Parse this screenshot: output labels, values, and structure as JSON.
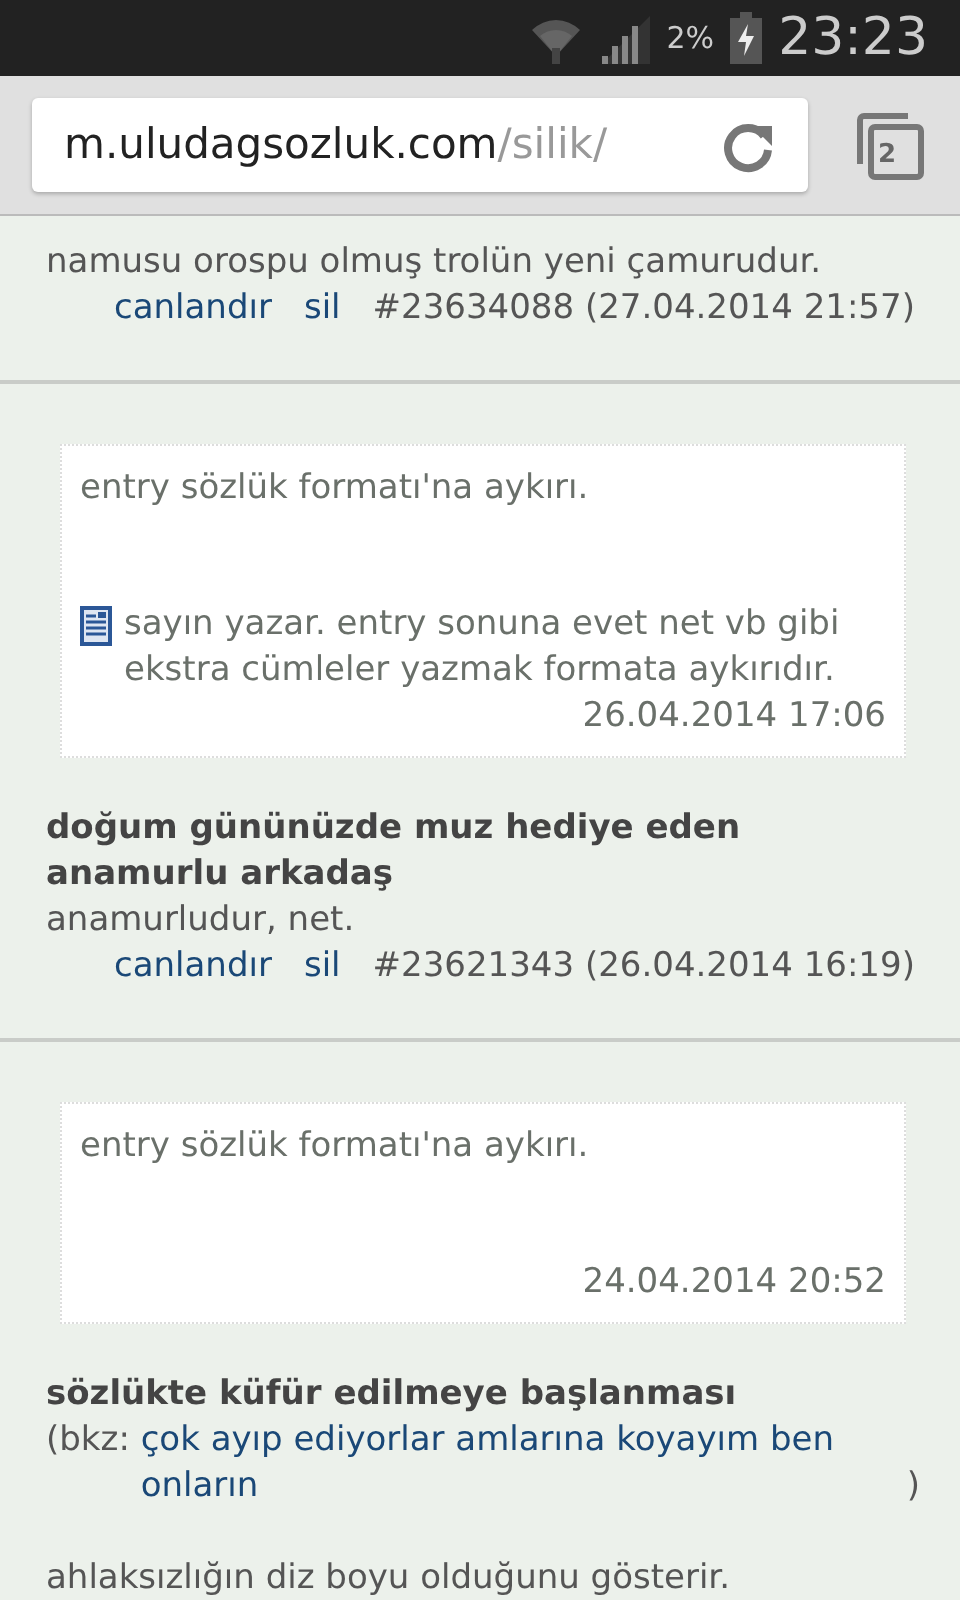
{
  "status_bar": {
    "battery": "2%",
    "time": "23:23"
  },
  "browser": {
    "url_host": "m.uludagsozluk.com",
    "url_path": "/silik/",
    "tab_count": "2"
  },
  "entries": [
    {
      "body": [
        {
          "kind": "text",
          "text": "namusu orospu olmuş trolün yeni çamurudur."
        }
      ],
      "actions": [
        "canlandır",
        "sil"
      ],
      "meta": "#23634088 (27.04.2014 21:57)"
    },
    {
      "notice": {
        "reason": "entry sözlük formatı'na aykırı.",
        "note": "sayın yazar. entry sonuna evet net vb gibi ekstra cümleler yazmak formata aykırıdır.",
        "date": "26.04.2014 17:06"
      },
      "title": "doğum gününüzde muz hediye eden anamurlu arkadaş",
      "body": [
        {
          "kind": "text",
          "text": "anamurludur, net."
        }
      ],
      "actions": [
        "canlandır",
        "sil"
      ],
      "meta": "#23621343 (26.04.2014 16:19)"
    },
    {
      "notice": {
        "reason": "entry sözlük formatı'na aykırı.",
        "date": "24.04.2014 20:52"
      },
      "title": "sözlükte küfür edilmeye başlanması",
      "body": [
        {
          "kind": "bkz",
          "prefix": "(bkz: ",
          "link": "çok ayıp ediyorlar amlarına koyayım ben onların",
          "suffix": ")"
        },
        {
          "kind": "text",
          "text": "ahlaksızlığın diz boyu olduğunu gösterir."
        }
      ]
    }
  ]
}
